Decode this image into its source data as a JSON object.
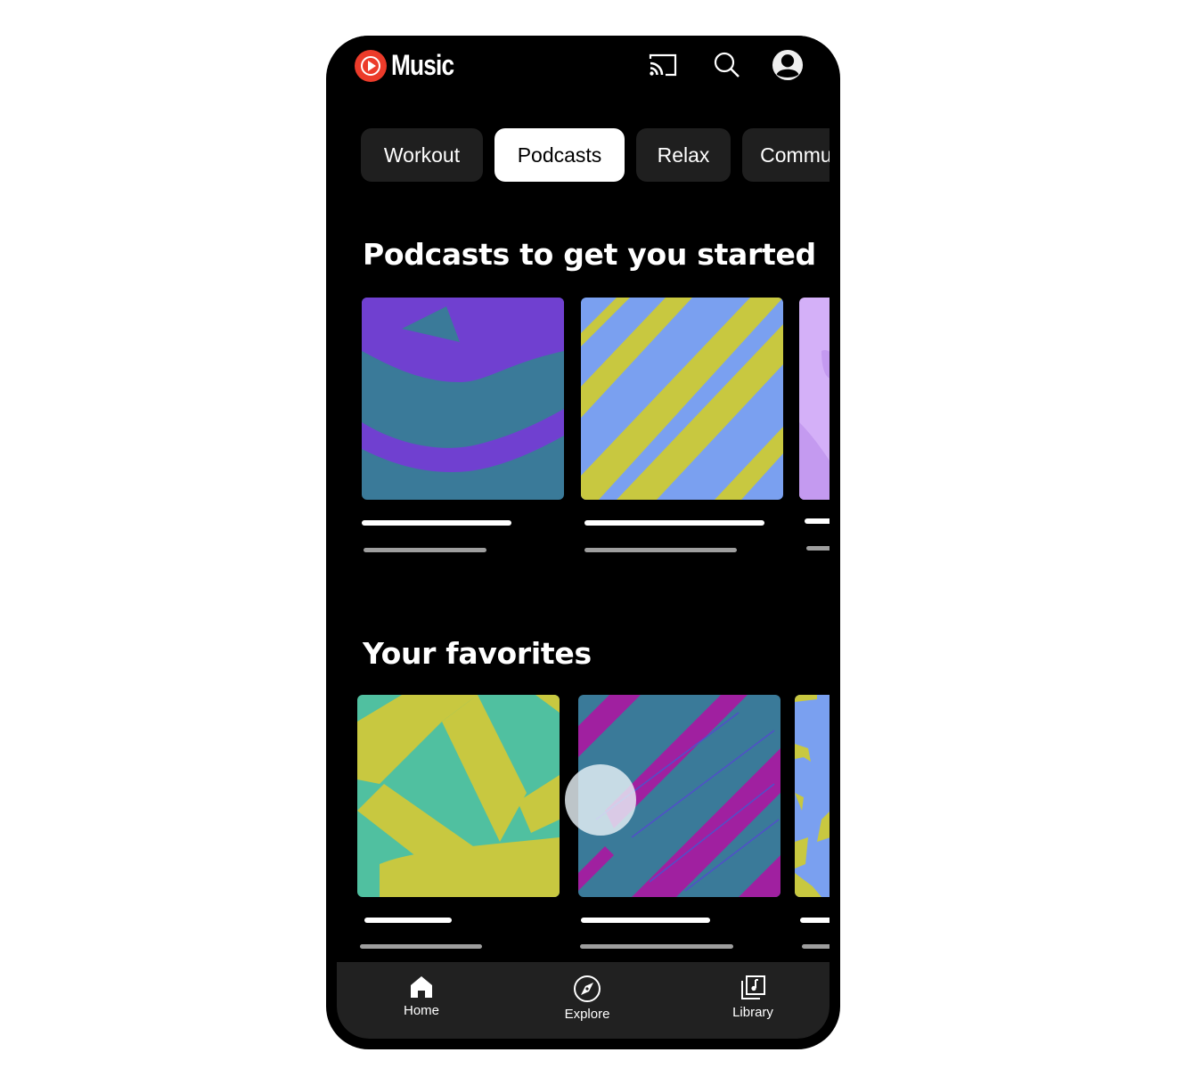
{
  "app": {
    "name": "Music",
    "brand_color": "#ec3b2a"
  },
  "topbar": {
    "icons": [
      "cast-icon",
      "search-icon",
      "account-icon"
    ]
  },
  "chips": [
    {
      "label": "Workout",
      "active": false
    },
    {
      "label": "Podcasts",
      "active": true
    },
    {
      "label": "Relax",
      "active": false
    },
    {
      "label": "Commute",
      "active": false
    }
  ],
  "sections": [
    {
      "title": "Podcasts to get you started",
      "cards": [
        {
          "art": "purple-teal-arcs",
          "colors": [
            "#3a7a99",
            "#7040d0"
          ]
        },
        {
          "art": "blue-yellow-stripes",
          "colors": [
            "#7aa0f0",
            "#c8c840"
          ]
        },
        {
          "art": "lavender",
          "colors": [
            "#d4b0f8",
            "#c49af0"
          ]
        }
      ]
    },
    {
      "title": "Your favorites",
      "cards": [
        {
          "art": "teal-yellow-strokes",
          "colors": [
            "#50c0a0",
            "#c8c840"
          ]
        },
        {
          "art": "magenta-teal-stripes",
          "colors": [
            "#3a7a99",
            "#a020a0"
          ]
        },
        {
          "art": "blue-yellow-patches",
          "colors": [
            "#7aa0f0",
            "#c8c840"
          ]
        }
      ]
    }
  ],
  "bottom_nav": [
    {
      "label": "Home",
      "icon": "home-icon",
      "active": true
    },
    {
      "label": "Explore",
      "icon": "explore-icon",
      "active": false
    },
    {
      "label": "Library",
      "icon": "library-icon",
      "active": false
    }
  ]
}
